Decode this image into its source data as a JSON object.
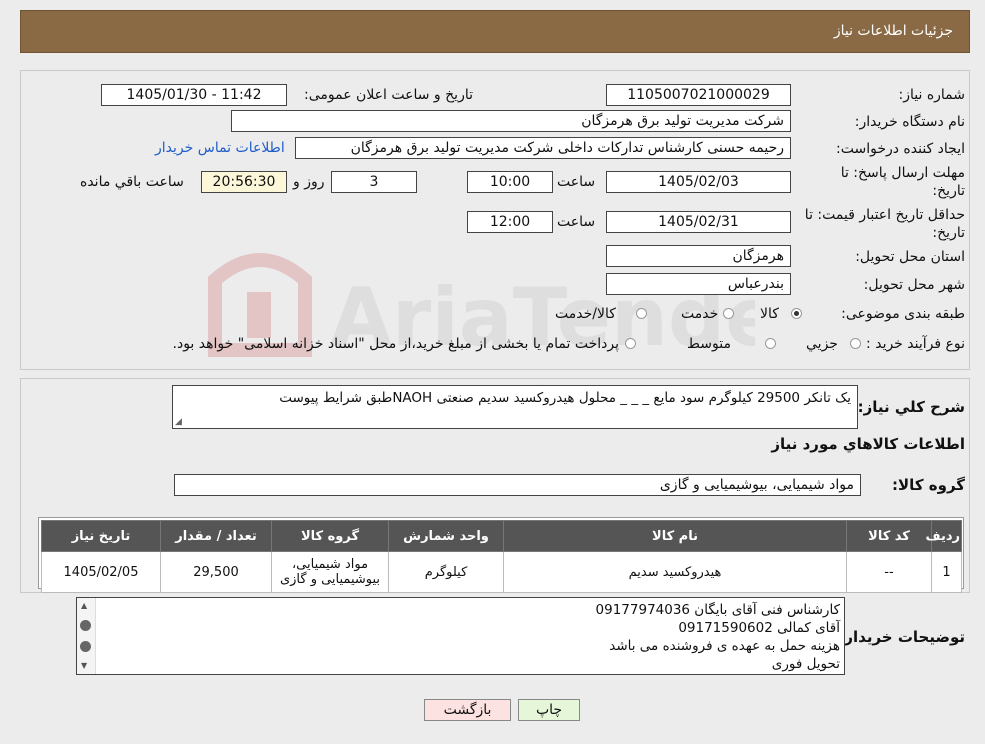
{
  "header": {
    "title": "جزئیات اطلاعات نیاز"
  },
  "fields": {
    "need_number_label": "شماره نیاز:",
    "need_number": "1105007021000029",
    "announce_label": "تاریخ و ساعت اعلان عمومی:",
    "announce_value": "1405/01/30 - 11:42",
    "buyer_org_label": "نام دستگاه خریدار:",
    "buyer_org": "شرکت مدیریت تولید برق هرمزگان",
    "requester_label": "ایجاد کننده درخواست:",
    "requester": "رحیمه حسنی کارشناس تدارکات داخلی شرکت مدیریت تولید برق هرمزگان",
    "contact_link": "اطلاعات تماس خریدار",
    "deadline_label_1": "مهلت ارسال پاسخ: تا",
    "deadline_label_2": "تاریخ:",
    "deadline_date": "1405/02/03",
    "time_label": "ساعت",
    "deadline_time": "10:00",
    "days_value": "3",
    "days_label": "روز و",
    "remaining_time": "20:56:30",
    "remaining_label": "ساعت باقي مانده",
    "validity_label_1": "حداقل تاریخ اعتبار قیمت: تا",
    "validity_label_2": "تاریخ:",
    "validity_date": "1405/02/31",
    "validity_time": "12:00",
    "province_label": "استان محل تحویل:",
    "province": "هرمزگان",
    "city_label": "شهر محل تحویل:",
    "city": "بندرعباس",
    "category_label": "طبقه بندی موضوعی:",
    "category_options": [
      "کالا",
      "خدمت",
      "کالا/خدمت"
    ],
    "process_label": "نوع فرآیند خرید :",
    "process_options": [
      "جزیي",
      "متوسط"
    ],
    "process_note": "پرداخت تمام یا بخشی از مبلغ خرید،از محل \"اسناد خزانه اسلامی\" خواهد بود."
  },
  "description": {
    "label": "شرح کلي نياز:",
    "text": "یک تانکر 29500 کیلوگرم سود مایع _ _ _ محلول هیدروکسید سدیم صنعتی NAOHطبق شرایط پیوست"
  },
  "goods": {
    "section_title": "اطلاعات کالاهاي مورد نياز",
    "group_label": "گروه کالا:",
    "group_value": "مواد شیمیایی، بیوشیمیایی و  گازی",
    "columns": [
      "ردیف",
      "کد کالا",
      "نام کالا",
      "واحد شمارش",
      "گروه کالا",
      "تعداد / مقدار",
      "تاریخ نیاز"
    ],
    "rows": [
      [
        "1",
        "--",
        "هیدروکسید سدیم",
        "کیلوگرم",
        "مواد شیمیایی، بیوشیمیایی و گازی",
        "29,500",
        "1405/02/05"
      ]
    ]
  },
  "buyer_notes": {
    "label": "توضیحات خریدار:",
    "lines": [
      "کارشناس فنی آقای بایگان 09177974036",
      " آقای کمالی 09171590602",
      "هزینه حمل به عهده ی فروشنده می باشد",
      "تحویل فوری"
    ]
  },
  "buttons": {
    "print": "چاپ",
    "back": "بازگشت"
  },
  "watermark": {
    "text": "AriaTender.neT"
  },
  "colors": {
    "header_bg": "#8a6a44",
    "link": "#1e5dc9",
    "back_btn": "#fde2e2",
    "print_btn": "#e6f7d9"
  }
}
